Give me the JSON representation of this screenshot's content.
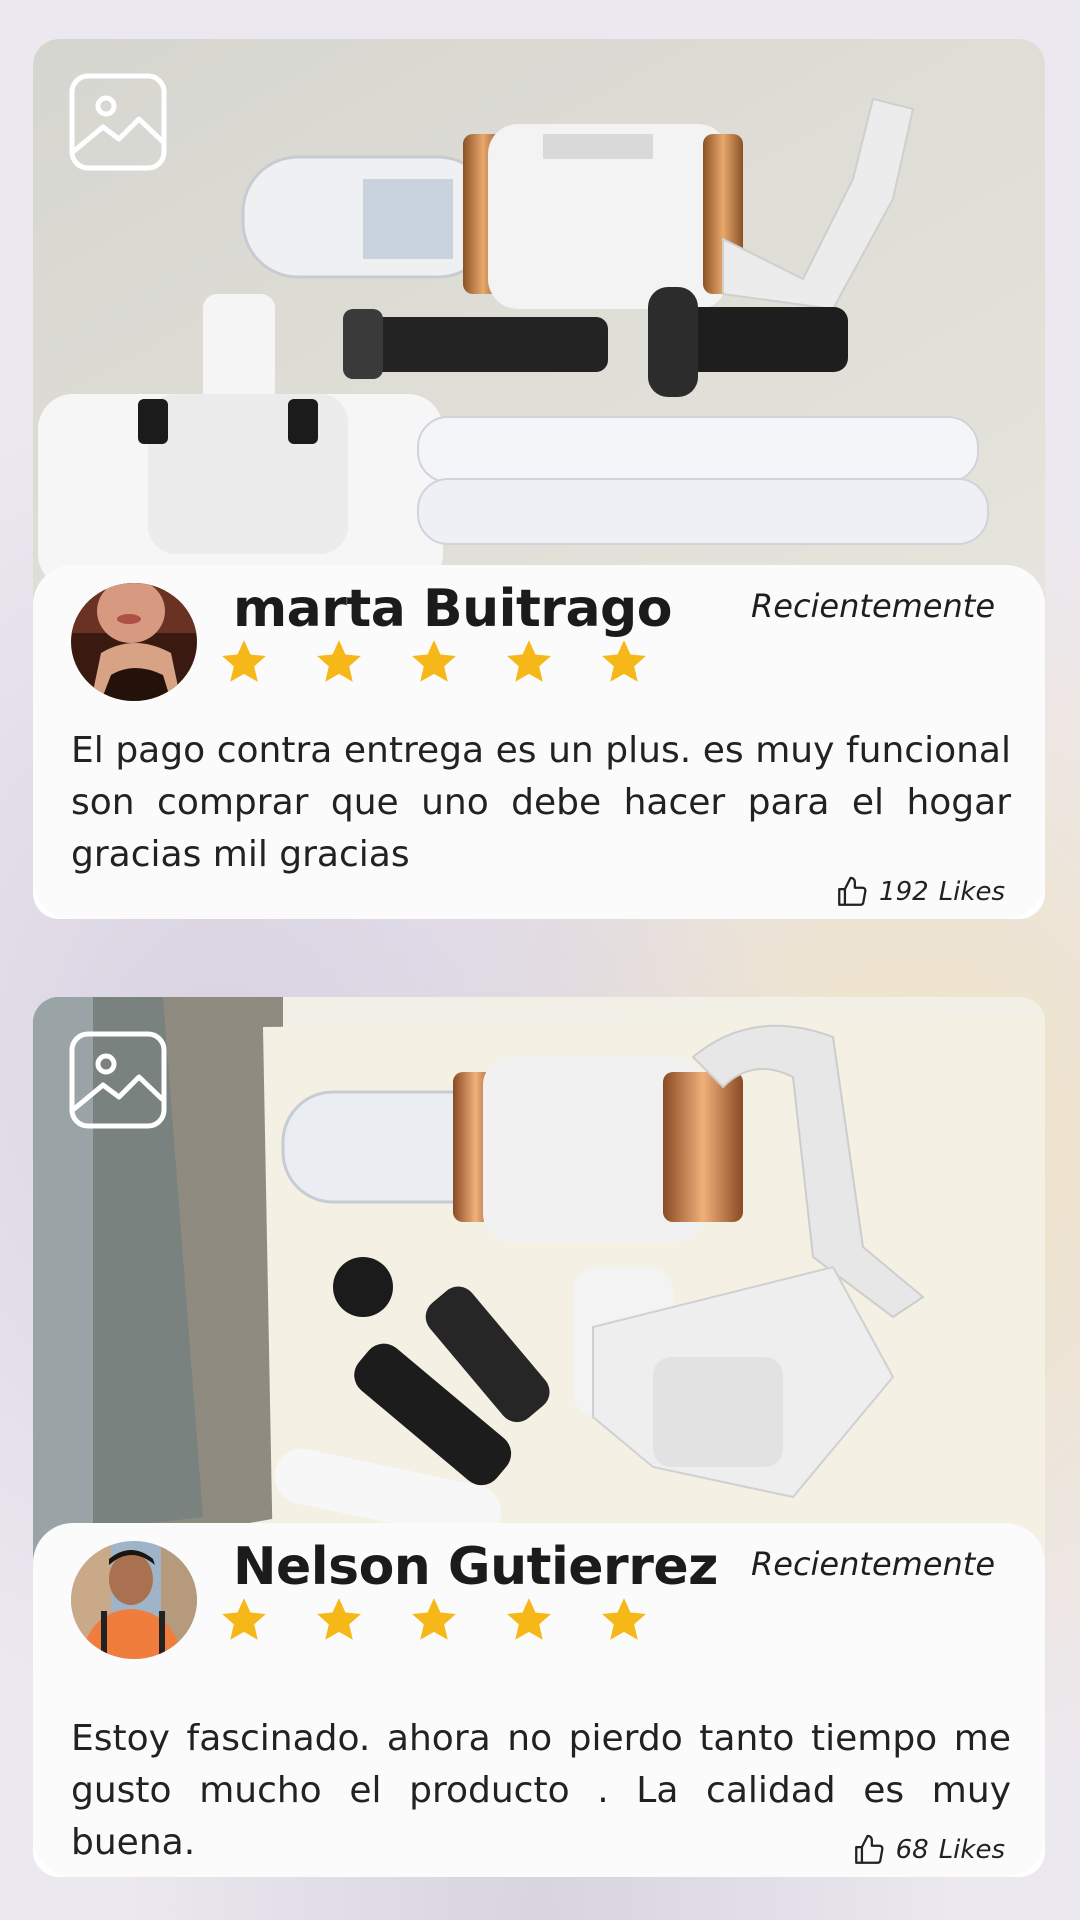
{
  "reviews": [
    {
      "name": "marta Buitrago",
      "date": "Recientemente",
      "rating": 5,
      "text": "El pago contra entrega es un plus. es muy funcional son comprar que uno debe hacer para el hogar gracias mil gracias",
      "likes_count": "192",
      "likes_label": "Likes",
      "photo_icon": "image-icon",
      "avatar": "woman-avatar"
    },
    {
      "name": "Nelson Gutierrez",
      "date": "Recientemente",
      "rating": 5,
      "text": "Estoy fascinado. ahora no pierdo tanto tiempo me gusto mucho el producto  . La calidad es muy buena.",
      "likes_count": "68",
      "likes_label": "Likes",
      "photo_icon": "image-icon",
      "avatar": "man-avatar"
    }
  ],
  "colors": {
    "star": "#f6b818",
    "card": "#fbfbfb",
    "text": "#222222"
  }
}
